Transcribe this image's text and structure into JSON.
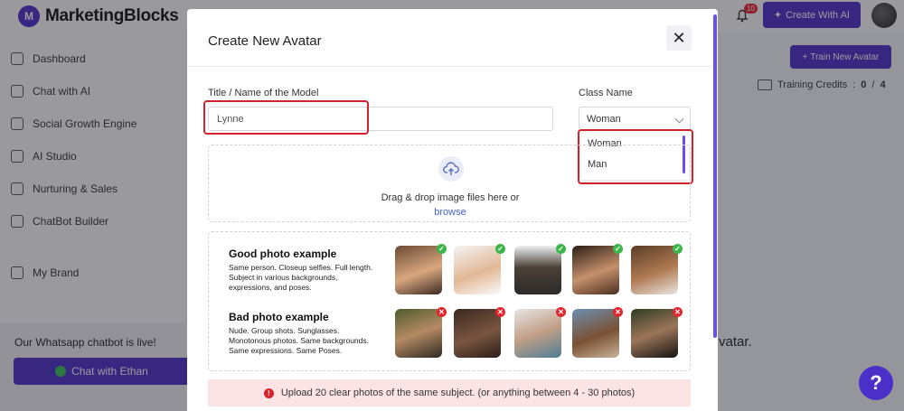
{
  "app": {
    "brand": "MarketingBlocks",
    "create_button": "Create With AI",
    "notification_count": "10"
  },
  "sidebar": {
    "items": [
      {
        "label": "Dashboard",
        "icon": "grid-icon"
      },
      {
        "label": "Chat with AI",
        "icon": "chat-icon"
      },
      {
        "label": "Social Growth Engine",
        "icon": "wand-icon"
      },
      {
        "label": "AI Studio",
        "icon": "layout-icon"
      },
      {
        "label": "Nurturing & Sales",
        "icon": "monitor-icon"
      },
      {
        "label": "ChatBot Builder",
        "icon": "bot-icon"
      },
      {
        "label": "My Brand",
        "icon": "brand-icon"
      }
    ],
    "whatsapp_text": "Our Whatsapp chatbot is live!",
    "whatsapp_button": "Chat with Ethan"
  },
  "page": {
    "train_button": "Train New Avatar",
    "credits_label": "Training Credits",
    "credits_used": "0",
    "credits_total": "4",
    "background_fragment": "vatar."
  },
  "modal": {
    "title": "Create New Avatar",
    "name_label": "Title / Name of the Model",
    "name_value": "Lynne",
    "class_label": "Class Name",
    "class_value": "Woman",
    "class_options": [
      "Woman",
      "Man"
    ],
    "drop_text": "Drag & drop image files here or",
    "browse_text": "browse",
    "good_title": "Good photo example",
    "good_desc": "Same person. Closeup selfies. Full length. Subject in various backgrounds, expressions, and poses.",
    "bad_title": "Bad photo example",
    "bad_desc": "Nude. Group shots. Sunglasses. Monotonous photos. Same backgrounds. Same expressions. Same Poses.",
    "warning": "Upload 20 clear photos of the same subject. (or anything between 4 - 30 photos)"
  },
  "colors": {
    "accent": "#4b2fc9",
    "highlight": "#d2232a",
    "ok_badge": "#3cb54a",
    "bad_badge": "#e2262d"
  }
}
